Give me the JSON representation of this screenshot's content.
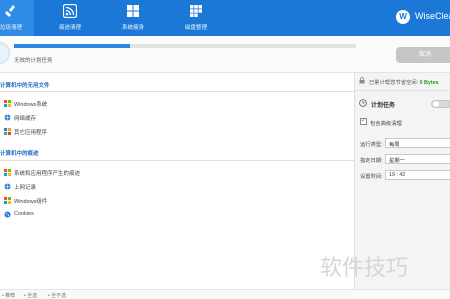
{
  "nav": {
    "items": [
      {
        "label": "垃圾清理",
        "icon": "broom-icon",
        "active": true
      },
      {
        "label": "痕迹清理",
        "icon": "rss-icon",
        "active": false
      },
      {
        "label": "系统瘦身",
        "icon": "windows-icon",
        "active": false
      },
      {
        "label": "磁盘整理",
        "icon": "disk-icon",
        "active": false
      }
    ]
  },
  "brand": {
    "logo_letter": "W",
    "name": "WiseClean"
  },
  "progress": {
    "fraction": 0.34,
    "status": "无效的计划任务",
    "cancel_label": "取消"
  },
  "sections": [
    {
      "title": "计算机中的无用文件",
      "items": [
        {
          "label": "Windows系统",
          "icon": "windows-icon"
        },
        {
          "label": "网络缓存",
          "icon": "globe-icon"
        },
        {
          "label": "其它应用程序",
          "icon": "apps-icon"
        }
      ]
    },
    {
      "title": "计算机中的痕迹",
      "items": [
        {
          "label": "系统和应用程序产生的痕迹",
          "icon": "windows-icon"
        },
        {
          "label": "上网记录",
          "icon": "globe-icon"
        },
        {
          "label": "Windows组件",
          "icon": "windows-icon"
        },
        {
          "label": "Cookies",
          "icon": "cookie-icon"
        }
      ]
    }
  ],
  "bottom": {
    "options": [
      "推荐",
      "全选",
      "全不选"
    ]
  },
  "right": {
    "space_label": "已累计帮您节省空间:",
    "space_value": "0 Bytes",
    "schedule_title": "计划任务",
    "schedule_enabled": false,
    "checkbox_label": "包含高级清理",
    "checkbox_checked": true,
    "fields": [
      {
        "label": "运行类型:",
        "value": "每周"
      },
      {
        "label": "指定日期:",
        "value": "星期一"
      },
      {
        "label": "设置时间:",
        "value": "19 : 42"
      }
    ]
  },
  "watermark": "软件技巧",
  "colors": {
    "accent": "#1c78d6",
    "section_title": "#1f6fc4",
    "saved_value": "#1f9d2a"
  }
}
